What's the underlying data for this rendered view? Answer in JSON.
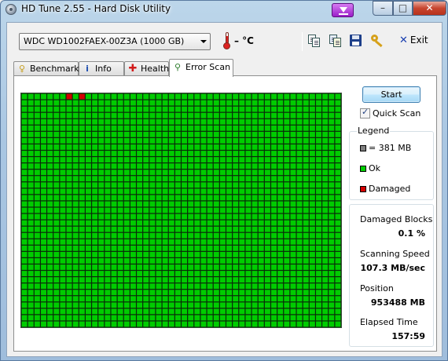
{
  "window": {
    "title": "HD Tune 2.55 - Hard Disk Utility",
    "controls": {
      "minimize": "–",
      "maximize": "□",
      "close": "✕"
    }
  },
  "toolbar": {
    "drive": "WDC WD1002FAEX-00Z3A (1000 GB)",
    "temperature": "– °C",
    "icons": [
      "copy-text-icon",
      "copy-screenshot-icon",
      "save-icon",
      "key-options-icon"
    ],
    "exit_label": "Exit"
  },
  "tabs": [
    {
      "label": "Benchmark",
      "icon": "benchmark-icon"
    },
    {
      "label": "Info",
      "icon": "info-icon"
    },
    {
      "label": "Health",
      "icon": "health-cross-icon"
    },
    {
      "label": "Error Scan",
      "icon": "magnifier-icon",
      "active": true
    }
  ],
  "scan": {
    "start_label": "Start",
    "quick_scan_label": "Quick Scan",
    "quick_scan_checked": true,
    "block_grid": {
      "columns": 50,
      "rows": 37,
      "damaged_blocks": [
        {
          "row": 0,
          "col": 7
        },
        {
          "row": 0,
          "col": 9
        }
      ]
    }
  },
  "legend": {
    "title": "Legend",
    "items": [
      {
        "label": "= 381 MB",
        "color": "#808080"
      },
      {
        "label": "Ok",
        "color": "#00cc00"
      },
      {
        "label": "Damaged",
        "color": "#d40000"
      }
    ]
  },
  "stats": {
    "damaged_blocks": {
      "label": "Damaged Blocks",
      "value": "0.1 %"
    },
    "scanning_speed": {
      "label": "Scanning Speed",
      "value": "107.3 MB/sec"
    },
    "position": {
      "label": "Position",
      "value": "953488 MB"
    },
    "elapsed_time": {
      "label": "Elapsed Time",
      "value": "157:59"
    }
  },
  "colors": {
    "ok": "#00cc00",
    "damaged": "#d40000",
    "grid_line": "#0a2a0a"
  }
}
